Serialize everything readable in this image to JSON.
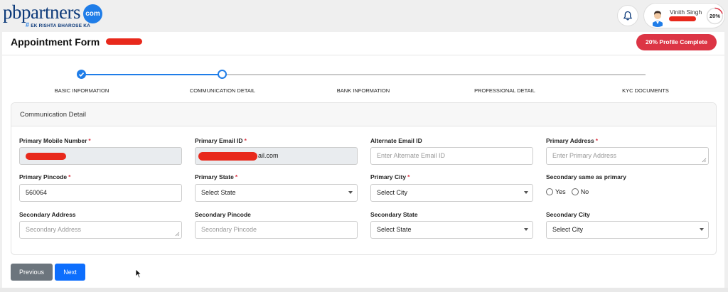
{
  "brand": {
    "name": "pbpartners",
    "com_badge": "com",
    "tagline": "EK RISHTA BHAROSE KA"
  },
  "user": {
    "name": "Vinith Singh",
    "profile_percent_text": "20%",
    "profile_fraction": 0.2
  },
  "page": {
    "title": "Appointment Form",
    "profile_badge": "20% Profile Complete"
  },
  "stepper": {
    "steps": [
      {
        "label": "BASIC INFORMATION",
        "state": "completed"
      },
      {
        "label": "COMMUNICATION DETAIL",
        "state": "current"
      },
      {
        "label": "BANK INFORMATION",
        "state": "pending"
      },
      {
        "label": "PROFESSIONAL DETAIL",
        "state": "pending"
      },
      {
        "label": "KYC DOCUMENTS",
        "state": "pending"
      }
    ]
  },
  "section": {
    "title": "Communication Detail",
    "fields": {
      "primary_mobile": {
        "label": "Primary Mobile Number",
        "required": "*",
        "value": ""
      },
      "primary_email": {
        "label": "Primary Email ID",
        "required": "*",
        "value_suffix": "ail.com"
      },
      "alternate_email": {
        "label": "Alternate Email ID",
        "placeholder": "Enter Alternate Email ID"
      },
      "primary_address": {
        "label": "Primary Address",
        "required": "*",
        "placeholder": "Enter Primary Address"
      },
      "primary_pincode": {
        "label": "Primary Pincode",
        "required": "*",
        "value": "560064"
      },
      "primary_state": {
        "label": "Primary State",
        "required": "*",
        "selected": "Select State"
      },
      "primary_city": {
        "label": "Primary City",
        "required": "*",
        "selected": "Select City"
      },
      "secondary_same": {
        "label": "Secondary same as primary",
        "yes": "Yes",
        "no": "No"
      },
      "secondary_address": {
        "label": "Secondary Address",
        "placeholder": "Secondary Address"
      },
      "secondary_pincode": {
        "label": "Secondary Pincode",
        "placeholder": "Secondary Pincode"
      },
      "secondary_state": {
        "label": "Secondary State",
        "selected": "Select State"
      },
      "secondary_city": {
        "label": "Secondary City",
        "selected": "Select City"
      }
    }
  },
  "buttons": {
    "previous": "Previous",
    "next": "Next"
  },
  "colors": {
    "brand_blue": "#0d3a7a",
    "accent_blue": "#1f7de8",
    "danger": "#dc3545",
    "redaction": "#e8291c",
    "primary_button": "#0d6efd",
    "secondary_button": "#6c757d"
  }
}
